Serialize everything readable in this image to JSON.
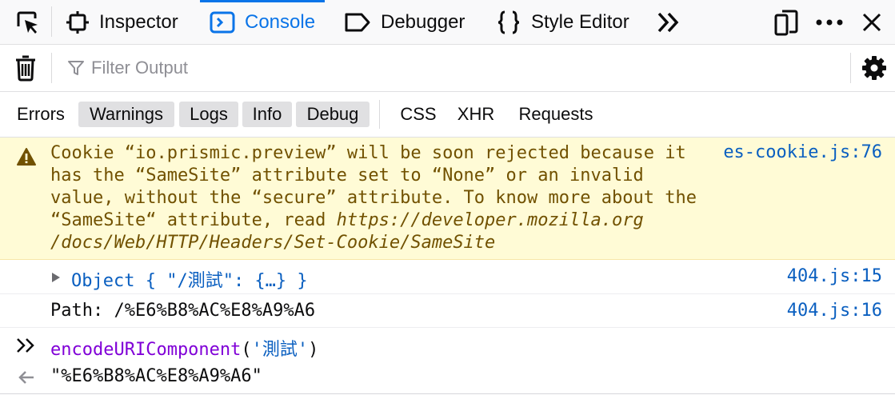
{
  "toolbar": {
    "tabs": [
      {
        "label": "Inspector",
        "icon": "inspector-icon"
      },
      {
        "label": "Console",
        "icon": "console-icon",
        "selected": true
      },
      {
        "label": "Debugger",
        "icon": "debugger-icon"
      },
      {
        "label": "Style Editor",
        "icon": "style-editor-icon"
      }
    ],
    "accent": "#0a74e8"
  },
  "filter": {
    "placeholder": "Filter Output"
  },
  "categories": {
    "errors": "Errors",
    "warnings": "Warnings",
    "logs": "Logs",
    "info": "Info",
    "debug": "Debug",
    "css": "CSS",
    "xhr": "XHR",
    "requests": "Requests"
  },
  "messages": {
    "warning": {
      "text_before": "Cookie “io.prismic.preview” will be soon rejected because it\nhas the “SameSite” attribute set to “None” or an invalid\nvalue, without the “secure” attribute. To know more about the\n“SameSite“ attribute, read ",
      "url": "https://developer.mozilla.org\n/docs/Web/HTTP/Headers/Set-Cookie/SameSite",
      "source": "es-cookie.js:76",
      "color": "#715100",
      "background": "#fffbd6"
    },
    "object_log": {
      "text": "Object { \"/測試\": {…} }",
      "source": "404.js:15"
    },
    "path_log": {
      "text": "Path: /%E6%B8%AC%E8%A9%A6",
      "source": "404.js:16"
    },
    "command": {
      "fn": "encodeURIComponent",
      "open": "(",
      "arg": "'測試'",
      "close": ")"
    },
    "result": {
      "text": "\"%E6%B8%AC%E8%A9%A6\""
    }
  }
}
